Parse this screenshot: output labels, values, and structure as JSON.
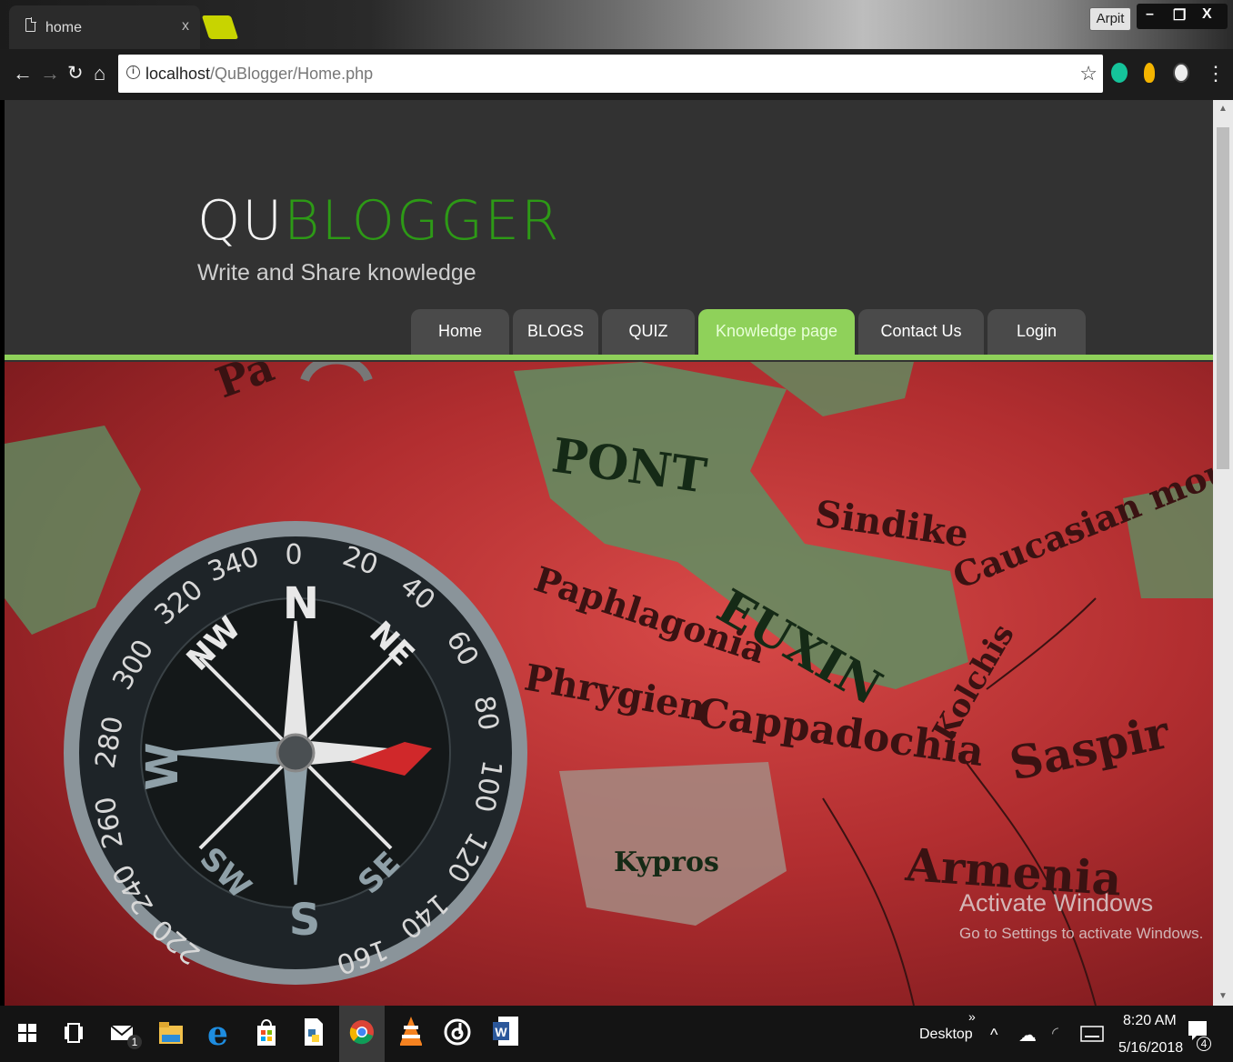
{
  "browser": {
    "tab_title": "home",
    "tab_close": "x",
    "profile_name": "Arpit",
    "url_host": "localhost",
    "url_path": "/QuBlogger/Home.php"
  },
  "site": {
    "logo_part1": "QU",
    "logo_part2": "BLOGGER",
    "tagline": "Write and Share knowledge",
    "accent_color": "#8fd15a",
    "logo_green": "#2d9a16",
    "menu": [
      {
        "label": "Home"
      },
      {
        "label": "BLOGS"
      },
      {
        "label": "QUIZ"
      },
      {
        "label": "Knowledge page",
        "active": true
      },
      {
        "label": "Contact Us"
      },
      {
        "label": "Login"
      }
    ]
  },
  "hero": {
    "compass_labels": [
      "N",
      "NE",
      "NW",
      "W",
      "S",
      "SE",
      "SW",
      "0",
      "20",
      "40",
      "60",
      "80",
      "100",
      "120",
      "140",
      "160",
      "220",
      "240",
      "260",
      "280",
      "300",
      "320",
      "340"
    ],
    "map_labels": [
      "PONT",
      "EUXIN",
      "Sindike",
      "Caucasian mount",
      "Paphlagonia",
      "Phrygien",
      "Cappadochia",
      "Kolchis",
      "Saspir",
      "Armenia",
      "Kypros",
      "Pa"
    ]
  },
  "watermark": {
    "title": "Activate Windows",
    "subtitle": "Go to Settings to activate Windows."
  },
  "taskbar": {
    "mail_badge": "1",
    "desktop_label": "Desktop",
    "more_chevron": "»",
    "up_caret": "^",
    "time": "8:20 AM",
    "date": "5/16/2018",
    "notification_count": "4"
  }
}
